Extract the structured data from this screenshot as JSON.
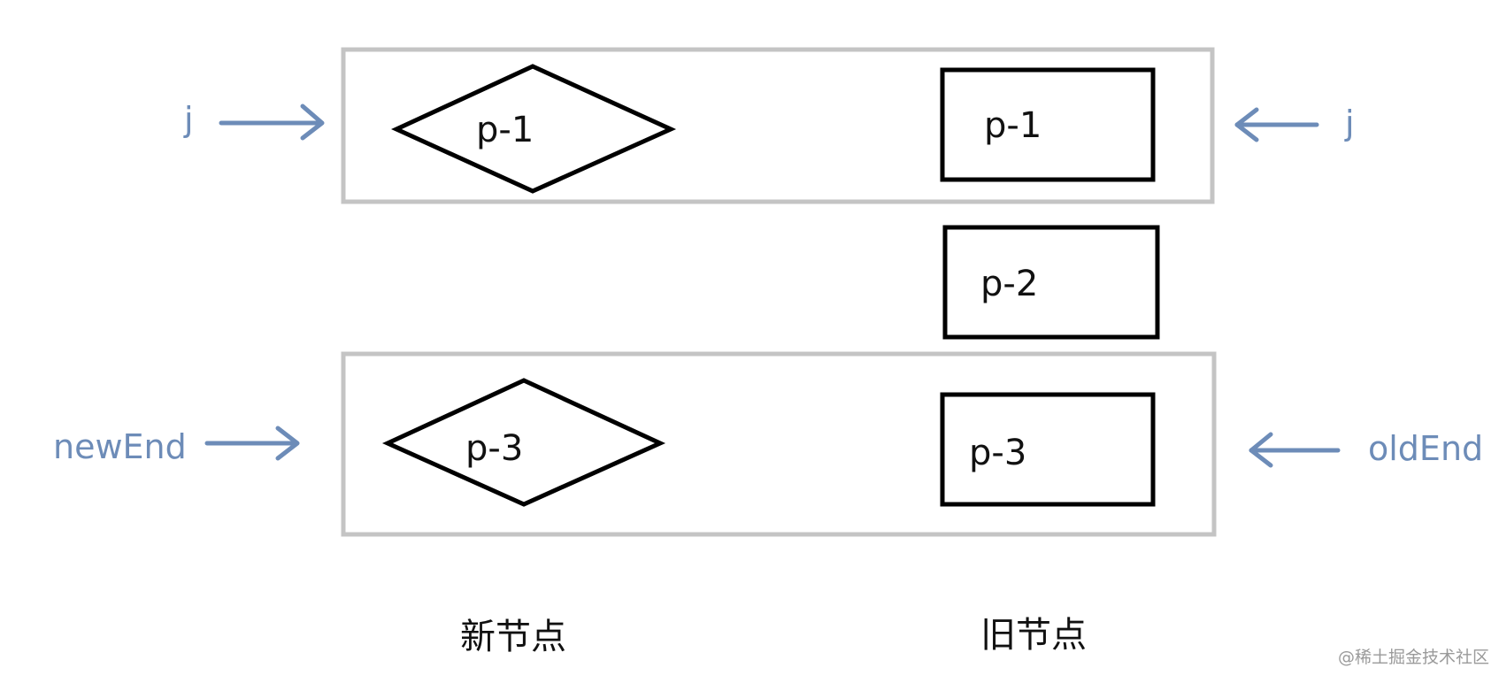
{
  "colors": {
    "pointer": "#6d8cb8",
    "group_border": "#c4c4c4",
    "node_stroke": "#000000"
  },
  "groups": {
    "top": {
      "new_node": "p-1",
      "old_node": "p-1"
    },
    "middle": {
      "old_node": "p-2"
    },
    "bottom": {
      "new_node": "p-3",
      "old_node": "p-3"
    }
  },
  "pointers": {
    "top_left": "j",
    "top_right": "j",
    "bottom_left": "newEnd",
    "bottom_right": "oldEnd"
  },
  "captions": {
    "new_nodes": "新节点",
    "old_nodes": "旧节点"
  },
  "watermark": "@稀土掘金技术社区"
}
